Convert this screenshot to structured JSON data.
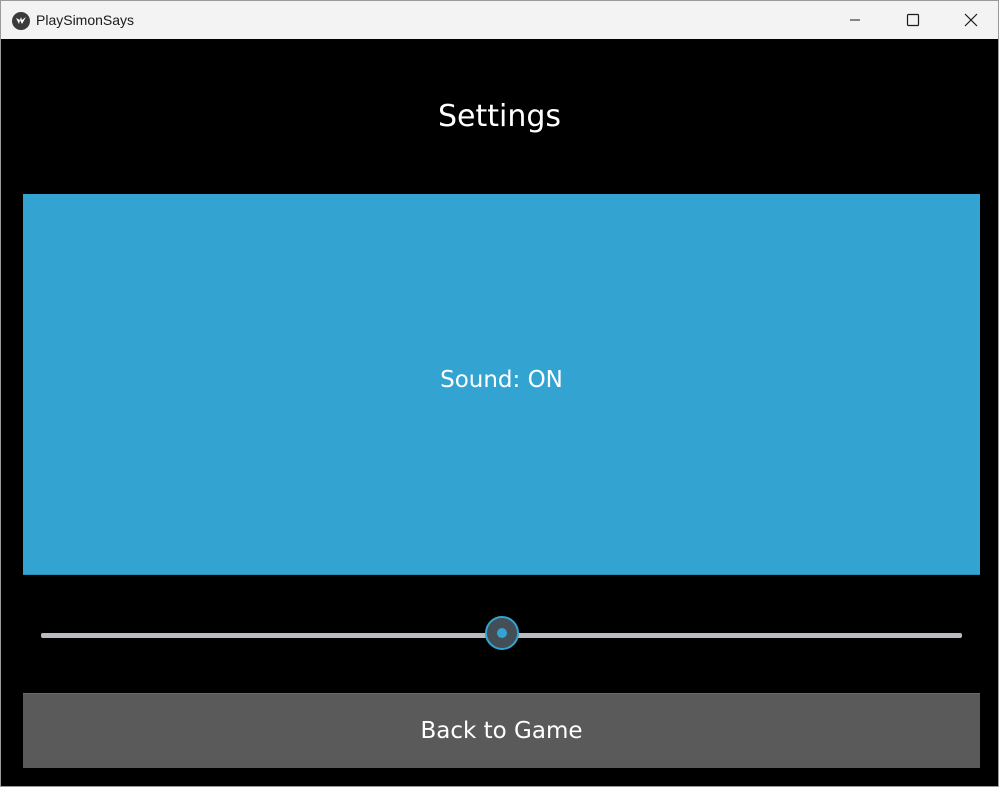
{
  "window": {
    "title": "PlaySimonSays",
    "app_icon": "kivy-logo-icon",
    "controls": [
      "minimize-icon",
      "maximize-icon",
      "close-icon"
    ]
  },
  "screen": {
    "title": "Settings",
    "sound_button_label": "Sound: ON",
    "volume_slider_value_fraction": 0.5,
    "back_button_label": "Back to Game"
  },
  "colors": {
    "accent": "#33a4d1",
    "background": "#000000",
    "button_gray": "#5a5a5a",
    "track": "#b8bcc0"
  }
}
